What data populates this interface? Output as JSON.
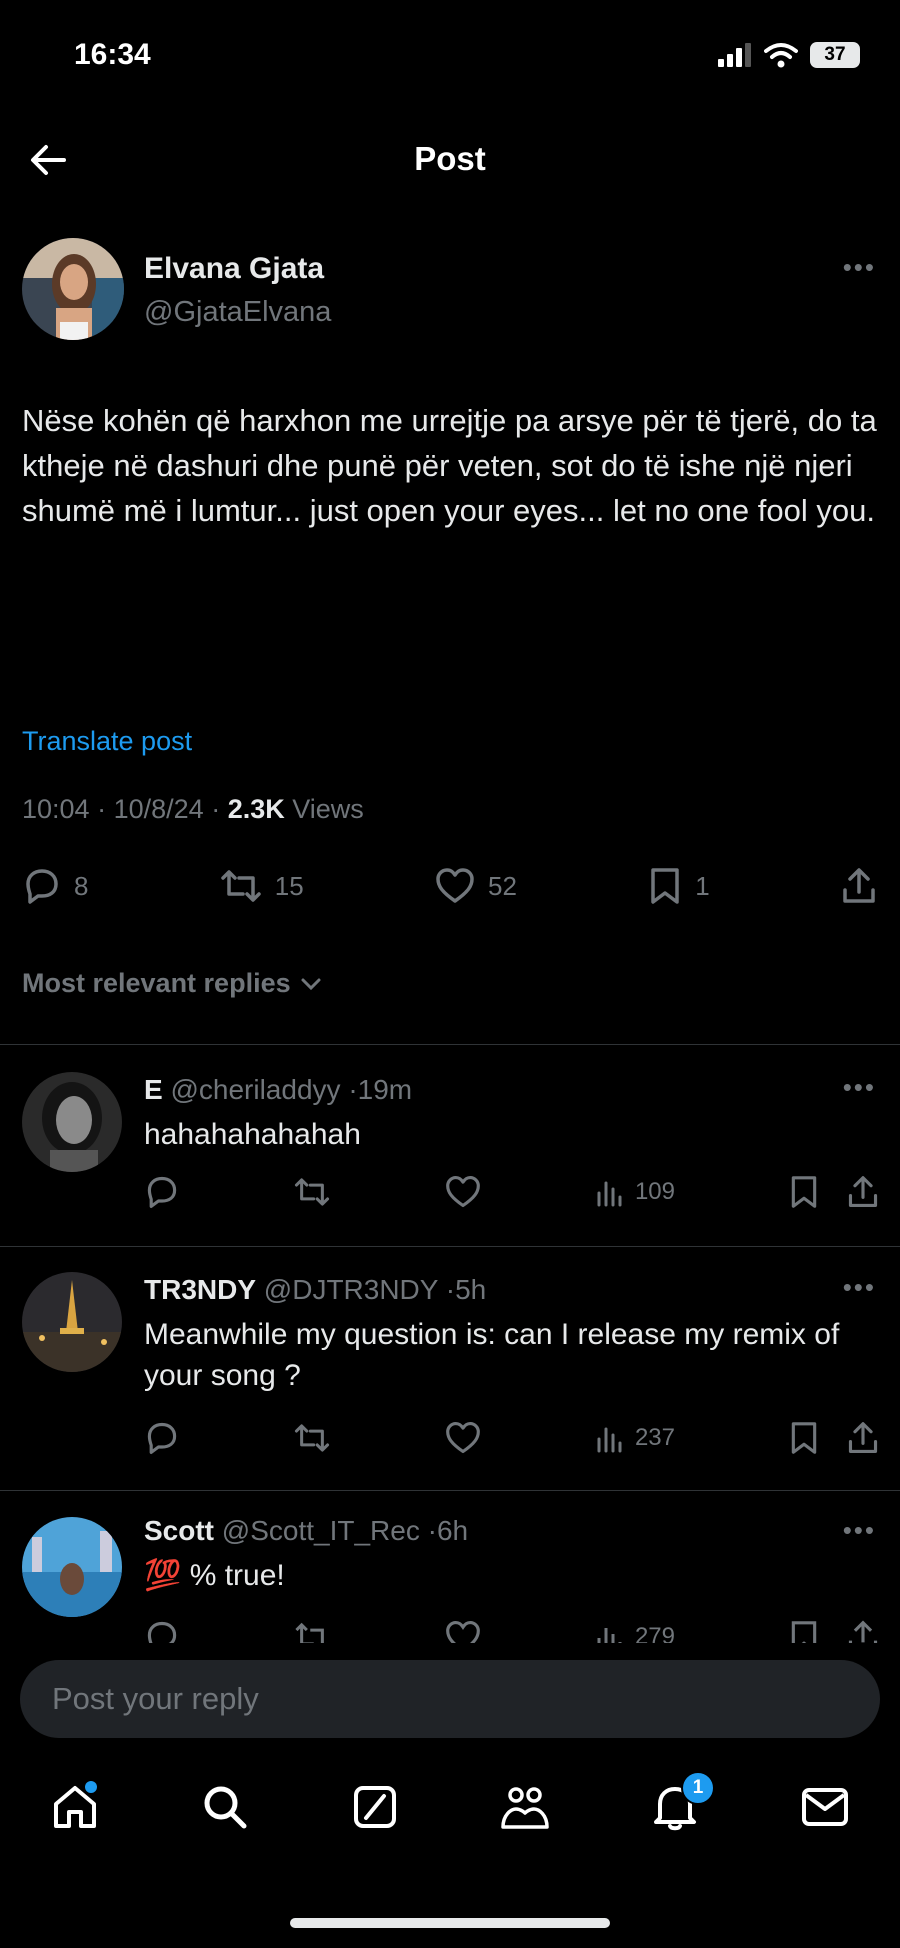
{
  "status": {
    "time": "16:34",
    "battery": "37"
  },
  "header": {
    "title": "Post"
  },
  "post": {
    "author_name": "Elvana Gjata",
    "author_handle": "@GjataElvana",
    "text": "Nëse kohën që harxhon me urrejtje pa arsye për të tjerë, do ta ktheje në dashuri dhe punë për veten, sot do të ishe një njeri shumë më i lumtur... just open your eyes... let no one fool you.",
    "translate": "Translate post",
    "time": "10:04",
    "date": "10/8/24",
    "views_count": "2.3K",
    "views_label": "Views",
    "replies": "8",
    "reposts": "15",
    "likes": "52",
    "bookmarks": "1"
  },
  "sort": {
    "label": "Most relevant replies"
  },
  "replies": [
    {
      "name": "E",
      "handle": "@cheriladdyy",
      "time": "19m",
      "text": "hahahahahahah",
      "views": "109"
    },
    {
      "name": "TR3NDY",
      "handle": "@DJTR3NDY",
      "time": "5h",
      "text": "Meanwhile my question is: can I release my remix of your song ?",
      "views": "237"
    },
    {
      "name": "Scott",
      "handle": "@Scott_IT_Rec",
      "time": "6h",
      "text": "💯 % true!",
      "views": "279"
    }
  ],
  "composer": {
    "placeholder": "Post your reply"
  },
  "nav": {
    "notifications_badge": "1"
  },
  "colors": {
    "accent": "#1d9bf0",
    "background": "#000000",
    "muted": "#71767b",
    "text": "#e7e9ea"
  }
}
